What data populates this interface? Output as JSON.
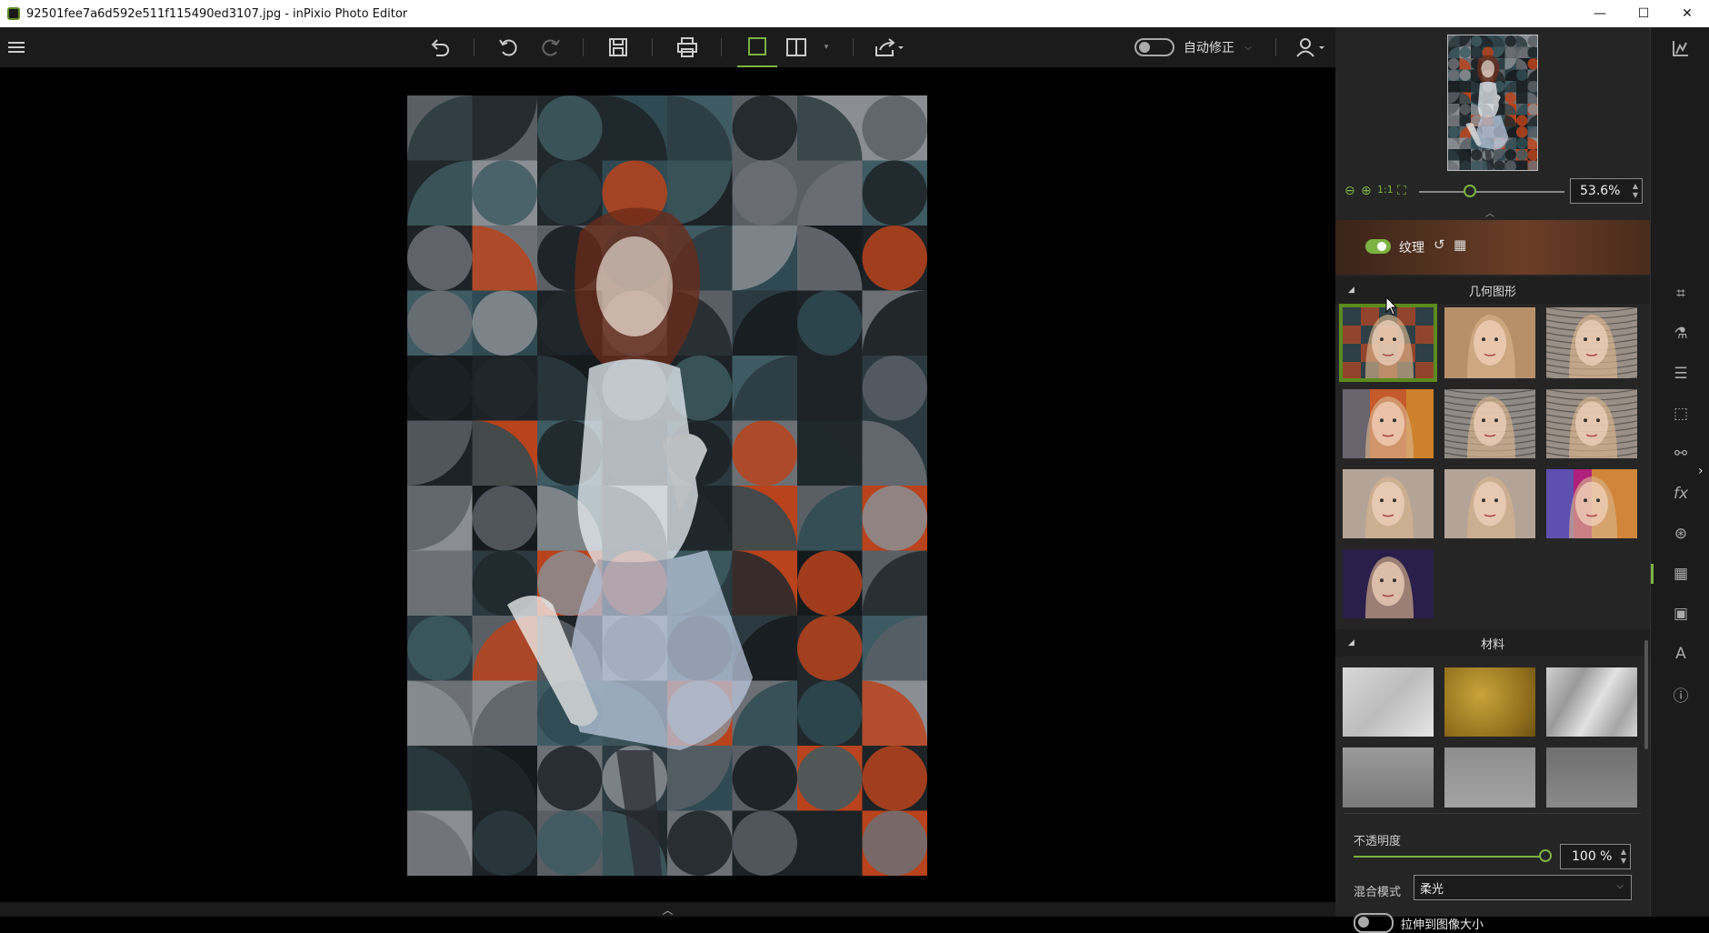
{
  "window": {
    "title": "92501fee7a6d592e511f115490ed3107.jpg - inPixio Photo Editor",
    "minimize": "—",
    "maximize": "☐",
    "close": "✕"
  },
  "toolbar": {
    "auto_fix_label": "自动修正",
    "auto_fix_on": false
  },
  "navigator": {
    "zoom_value": "53.6%",
    "zoom_level": 0.536
  },
  "texture": {
    "label": "纹理",
    "enabled": true
  },
  "sections": {
    "geometric": "几何图形",
    "materials": "材料"
  },
  "settings": {
    "opacity_label": "不透明度",
    "opacity_value": "100 %",
    "opacity_level": 1.0,
    "blend_label": "混合模式",
    "blend_value": "柔光",
    "stretch_label": "拉伸到图像大小",
    "stretch_on": false
  },
  "colors": {
    "accent": "#7cb342",
    "panel": "#252525",
    "toolbar": "#1b1b1b"
  }
}
